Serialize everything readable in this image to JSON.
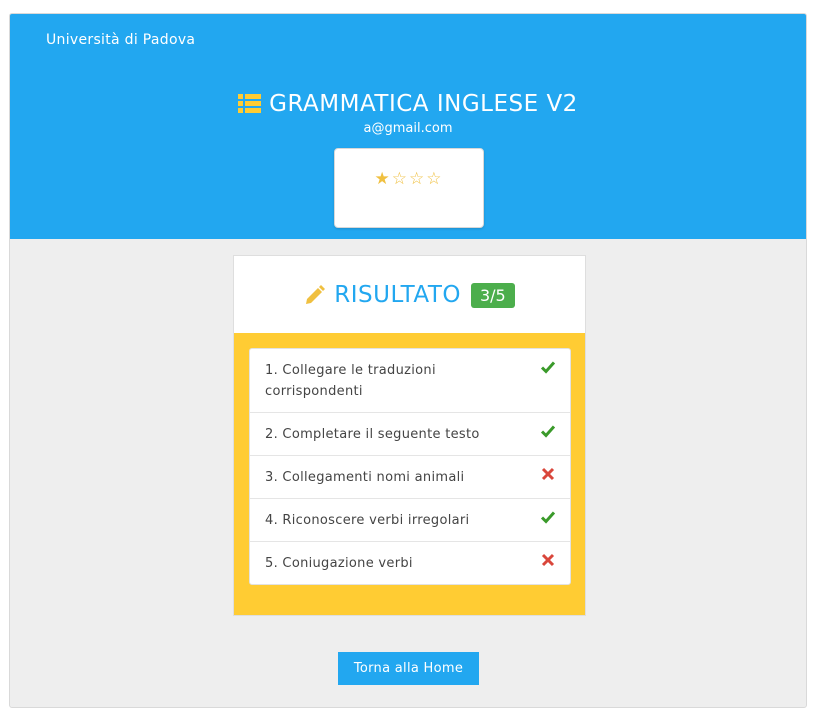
{
  "header": {
    "university": "Università di Padova",
    "title": "GRAMMATICA INGLESE V2",
    "email": "a@gmail.com",
    "stars": "★☆☆☆",
    "rating": {
      "filled": 1,
      "total": 4
    },
    "color": "#22a7f0"
  },
  "result": {
    "title": "RISULTATO",
    "score": "3/5",
    "items": [
      {
        "label": "1. Collegare le traduzioni corrispondenti",
        "correct": true
      },
      {
        "label": "2. Completare il seguente testo",
        "correct": true
      },
      {
        "label": "3. Collegamenti nomi animali",
        "correct": false
      },
      {
        "label": "4. Riconoscere verbi irregolari",
        "correct": true
      },
      {
        "label": "5. Coniugazione verbi",
        "correct": false
      }
    ],
    "colors": {
      "correct": "#3a9a2a",
      "wrong": "#d9463b",
      "panel": "#ffcc33",
      "badge": "#4cae4c"
    }
  },
  "home_button": {
    "label": "Torna alla Home"
  }
}
